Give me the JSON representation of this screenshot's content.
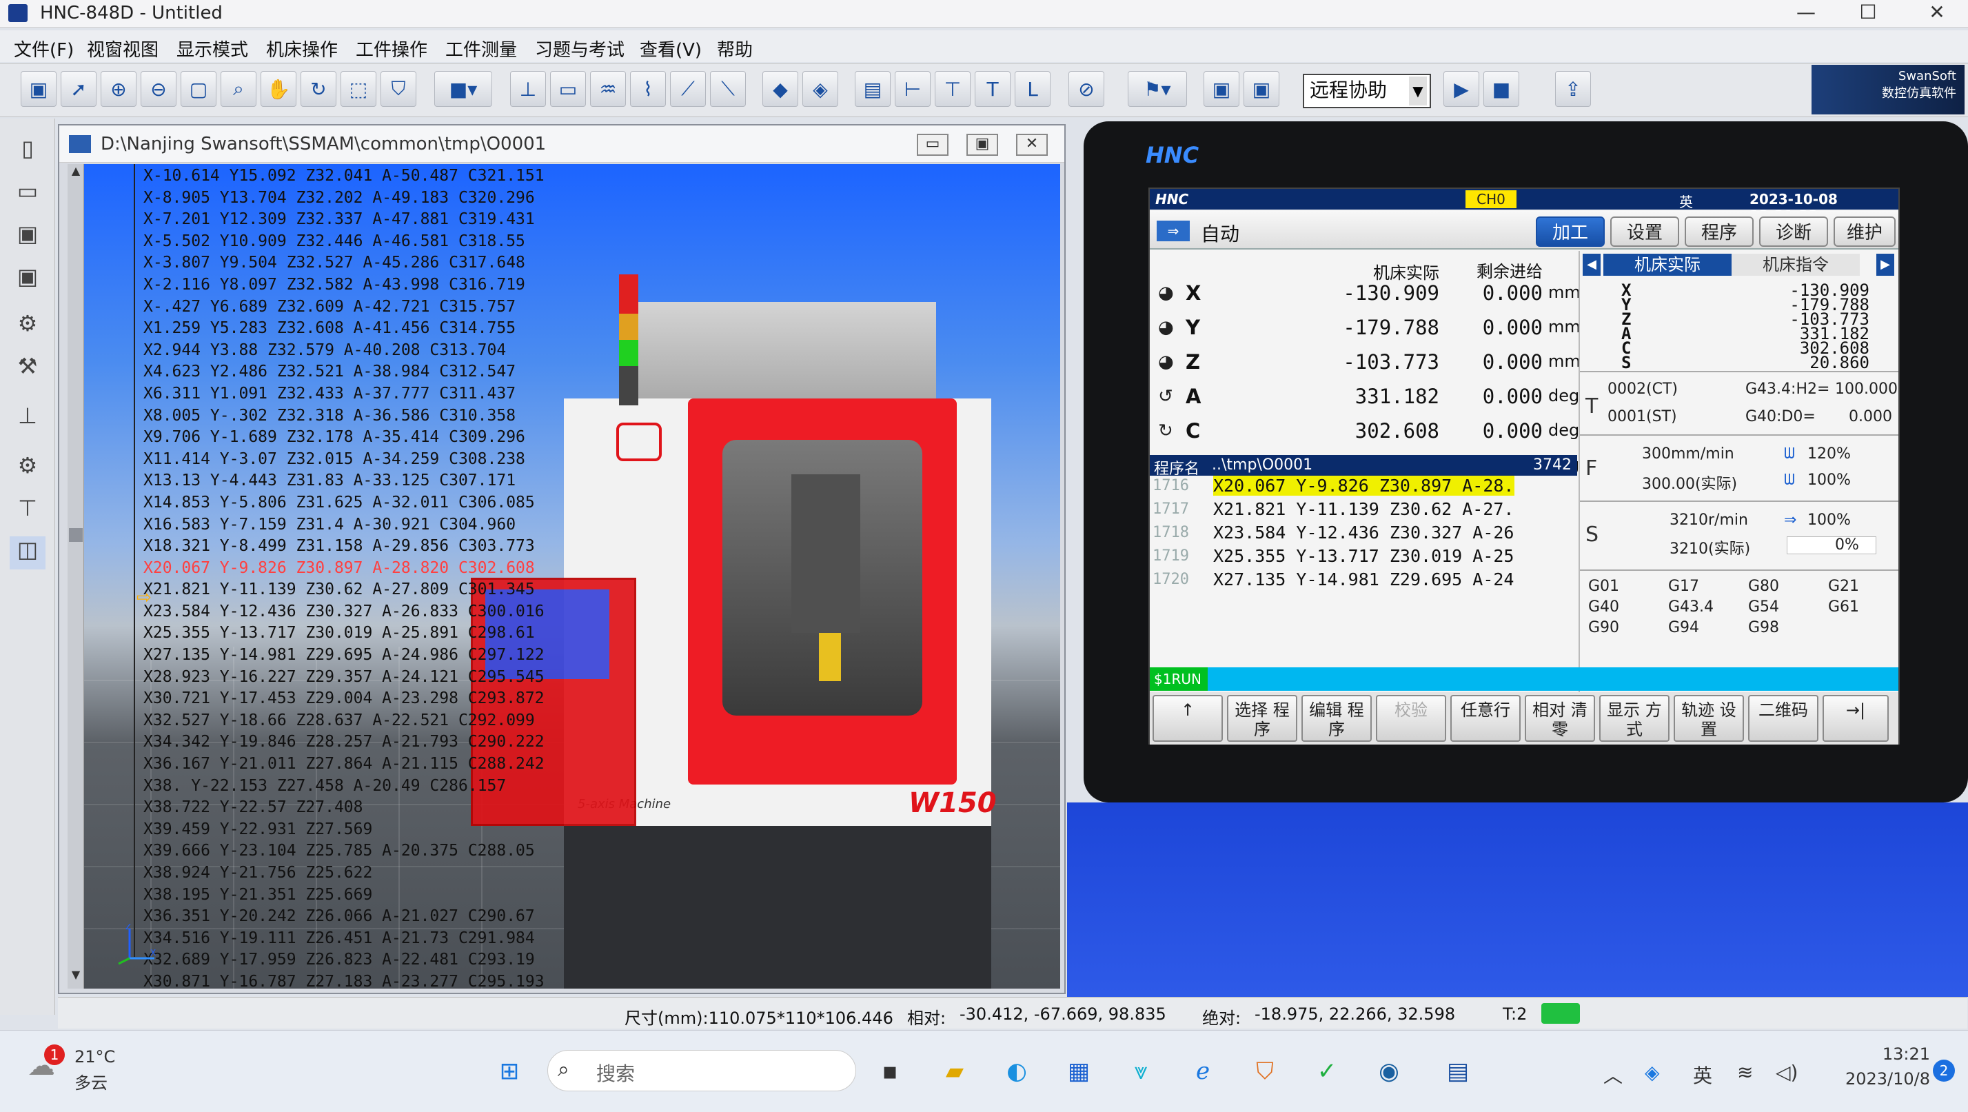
{
  "window": {
    "title": "HNC-848D - Untitled",
    "min": "—",
    "max": "☐",
    "close": "✕"
  },
  "menu": [
    "文件(F)",
    "视窗视图",
    "显示模式",
    "机床操作",
    "工件操作",
    "工件测量",
    "习题与考试",
    "查看(V)",
    "帮助"
  ],
  "toolbar": {
    "remote_assist": "远程协助",
    "brand_en": "SwanSoft",
    "brand_cn": "数控仿真软件"
  },
  "sim_window": {
    "path": "D:\\Nanjing Swansoft\\SSMAM\\common\\tmp\\O0001",
    "min": "▭",
    "restore": "▣",
    "close": "✕"
  },
  "code_lines": [
    "X-10.614 Y15.092 Z32.041 A-50.487 C321.151",
    "X-8.905 Y13.704 Z32.202 A-49.183 C320.296",
    "X-7.201 Y12.309 Z32.337 A-47.881 C319.431",
    "X-5.502 Y10.909 Z32.446 A-46.581 C318.55",
    "X-3.807 Y9.504 Z32.527 A-45.286 C317.648",
    "X-2.116 Y8.097 Z32.582 A-43.998 C316.719",
    "X-.427 Y6.689 Z32.609 A-42.721 C315.757",
    "X1.259 Y5.283 Z32.608 A-41.456 C314.755",
    "X2.944 Y3.88 Z32.579 A-40.208 C313.704",
    "X4.623 Y2.486 Z32.521 A-38.984 C312.547",
    "X6.311 Y1.091 Z32.433 A-37.777 C311.437",
    "X8.005 Y-.302 Z32.318 A-36.586 C310.358",
    "X9.706 Y-1.689 Z32.178 A-35.414 C309.296",
    "X11.414 Y-3.07 Z32.015 A-34.259 C308.238",
    "X13.13 Y-4.443 Z31.83 A-33.125 C307.171",
    "X14.853 Y-5.806 Z31.625 A-32.011 C306.085",
    "X16.583 Y-7.159 Z31.4 A-30.921 C304.960",
    "X18.321 Y-8.499 Z31.158 A-29.856 C303.773",
    "X20.067 Y-9.826 Z30.897 A-28.820 C302.608",
    "X21.821 Y-11.139 Z30.62 A-27.809 C301.345",
    "X23.584 Y-12.436 Z30.327 A-26.833 C300.016",
    "X25.355 Y-13.717 Z30.019 A-25.891 C298.61",
    "X27.135 Y-14.981 Z29.695 A-24.986 C297.122",
    "X28.923 Y-16.227 Z29.357 A-24.121 C295.545",
    "X30.721 Y-17.453 Z29.004 A-23.298 C293.872",
    "X32.527 Y-18.66 Z28.637 A-22.521 C292.099",
    "X34.342 Y-19.846 Z28.257 A-21.793 C290.222",
    "X36.167 Y-21.011 Z27.864 A-21.115 C288.242",
    "X38. Y-22.153 Z27.458 A-20.49 C286.157",
    "X38.722 Y-22.57 Z27.408",
    "X39.459 Y-22.931 Z27.569",
    "X39.666 Y-23.104 Z25.785 A-20.375 C288.05",
    "X38.924 Y-21.756 Z25.622",
    "X38.195 Y-21.351 Z25.669",
    "X36.351 Y-20.242 Z26.066 A-21.027 C290.67",
    "X34.516 Y-19.111 Z26.451 A-21.73 C291.984",
    "X32.689 Y-17.959 Z26.823 A-22.481 C293.19",
    "X30.871 Y-16.787 Z27.183 A-23.277 C295.193"
  ],
  "current_line_index": 18,
  "machine": {
    "label": "5-axis Machine",
    "model": "W150"
  },
  "status": {
    "size": "尺寸(mm):110.075*110*106.446",
    "rel_label": "相对:",
    "rel": "-30.412,   -67.669,   98.835",
    "abs_label": "绝对:",
    "abs": "-18.975,   22.266,   32.598",
    "tool": "T:2"
  },
  "cnc": {
    "logo": "HNC",
    "ch": "CH0",
    "lang": "英",
    "datetime": "2023-10-08  13:21:33",
    "mode": "自动",
    "tabs": [
      "加工",
      "设置",
      "程序",
      "诊断",
      "维护"
    ],
    "head_actual": "机床实际",
    "head_remain": "剩余进给",
    "axes": [
      {
        "name": "X",
        "actual": "-130.909",
        "remain": "0.000",
        "unit": "mm"
      },
      {
        "name": "Y",
        "actual": "-179.788",
        "remain": "0.000",
        "unit": "mm"
      },
      {
        "name": "Z",
        "actual": "-103.773",
        "remain": "0.000",
        "unit": "mm"
      },
      {
        "name": "A",
        "actual": "331.182",
        "remain": "0.000",
        "unit": "deg"
      },
      {
        "name": "C",
        "actual": "302.608",
        "remain": "0.000",
        "unit": "deg"
      },
      {
        "name": "S",
        "actual": "20.860",
        "remain": "20.860",
        "unit": "deg"
      }
    ],
    "rp_tab1": "机床实际",
    "rp_tab2": "机床指令",
    "mac_axes": [
      [
        "X",
        "-130.909"
      ],
      [
        "Y",
        "-179.788"
      ],
      [
        "Z",
        "-103.773"
      ],
      [
        "A",
        "331.182"
      ],
      [
        "C",
        "302.608"
      ],
      [
        "S",
        "20.860"
      ]
    ],
    "T": "T",
    "tool1": "0002(CT)",
    "tool1b": "G43.4:H2=",
    "tool1c": "100.000",
    "tool2": "0001(ST)",
    "tool2b": "G40:D0=",
    "tool2c": "0.000",
    "F": "F",
    "feed1": "300mm/min",
    "feed1p": "120%",
    "feed2": "300.00(实际)",
    "feed2p": "100%",
    "S": "S",
    "spin1": "3210r/min",
    "spin1p": "100%",
    "spin2": "3210(实际)",
    "spin2p": "0%",
    "gcodes": [
      [
        "G01",
        "G17",
        "G80",
        "G21"
      ],
      [
        "G40",
        "G43.4",
        "G54",
        "G61"
      ],
      [
        "G90",
        "G94",
        "G98",
        ""
      ]
    ],
    "prog_head": "程序名",
    "prog_path": "..\\tmp\\O0001",
    "prog_count": "3742",
    "prog": [
      [
        "1716",
        "X20.067  Y-9.826  Z30.897  A-28."
      ],
      [
        "1717",
        "X21.821  Y-11.139  Z30.62  A-27."
      ],
      [
        "1718",
        "X23.584  Y-12.436  Z30.327  A-26"
      ],
      [
        "1719",
        "X25.355  Y-13.717  Z30.019  A-25"
      ],
      [
        "1720",
        "X27.135  Y-14.981  Z29.695  A-24"
      ]
    ],
    "srun": "$1RUN",
    "fkeys": [
      "↑",
      "选择 程序",
      "编辑 程序",
      "校验",
      "任意行",
      "相对 清零",
      "显示 方式",
      "轨迹 设置",
      "二维码",
      "→|"
    ]
  },
  "taskbar": {
    "temp": "21°C",
    "weather": "多云",
    "weather_badge": "1",
    "search": "搜索",
    "time": "13:21",
    "date": "2023/10/8",
    "notif": "2",
    "ime": "英"
  }
}
